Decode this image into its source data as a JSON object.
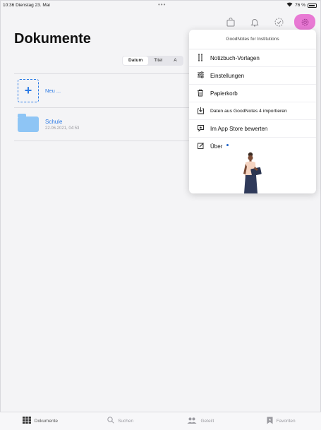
{
  "status": {
    "time": "10:36",
    "date": "Dienstag 23. Mai",
    "battery": "76 %"
  },
  "page": {
    "title": "Dokumente"
  },
  "sort": {
    "options": [
      "Datum",
      "Titel",
      "A"
    ],
    "selected": "Datum"
  },
  "list": {
    "new_label": "Neu ...",
    "folders": [
      {
        "name": "Schule",
        "date": "22.06.2021, 04:53"
      }
    ]
  },
  "menu": {
    "header": "GoodNotes for Institutions",
    "items": [
      {
        "label": "Notizbuch-Vorlagen",
        "icon": "template-icon"
      },
      {
        "label": "Einstellungen",
        "icon": "sliders-icon"
      },
      {
        "label": "Papierkorb",
        "icon": "trash-icon"
      },
      {
        "label": "Daten aus GoodNotes 4 importieren",
        "icon": "import-icon"
      },
      {
        "label": "Im App Store bewerten",
        "icon": "rate-icon"
      },
      {
        "label": "Über",
        "icon": "info-icon"
      }
    ]
  },
  "tabs": [
    {
      "label": "Dokumente",
      "icon": "grid-icon",
      "active": true
    },
    {
      "label": "Suchen",
      "icon": "search-icon",
      "active": false
    },
    {
      "label": "Geteilt",
      "icon": "people-icon",
      "active": false
    },
    {
      "label": "Favoriten",
      "icon": "bookmark-icon",
      "active": false
    }
  ],
  "colors": {
    "accent": "#2d7be5",
    "highlight": "#e879d4",
    "folder": "#8ec5f5"
  }
}
